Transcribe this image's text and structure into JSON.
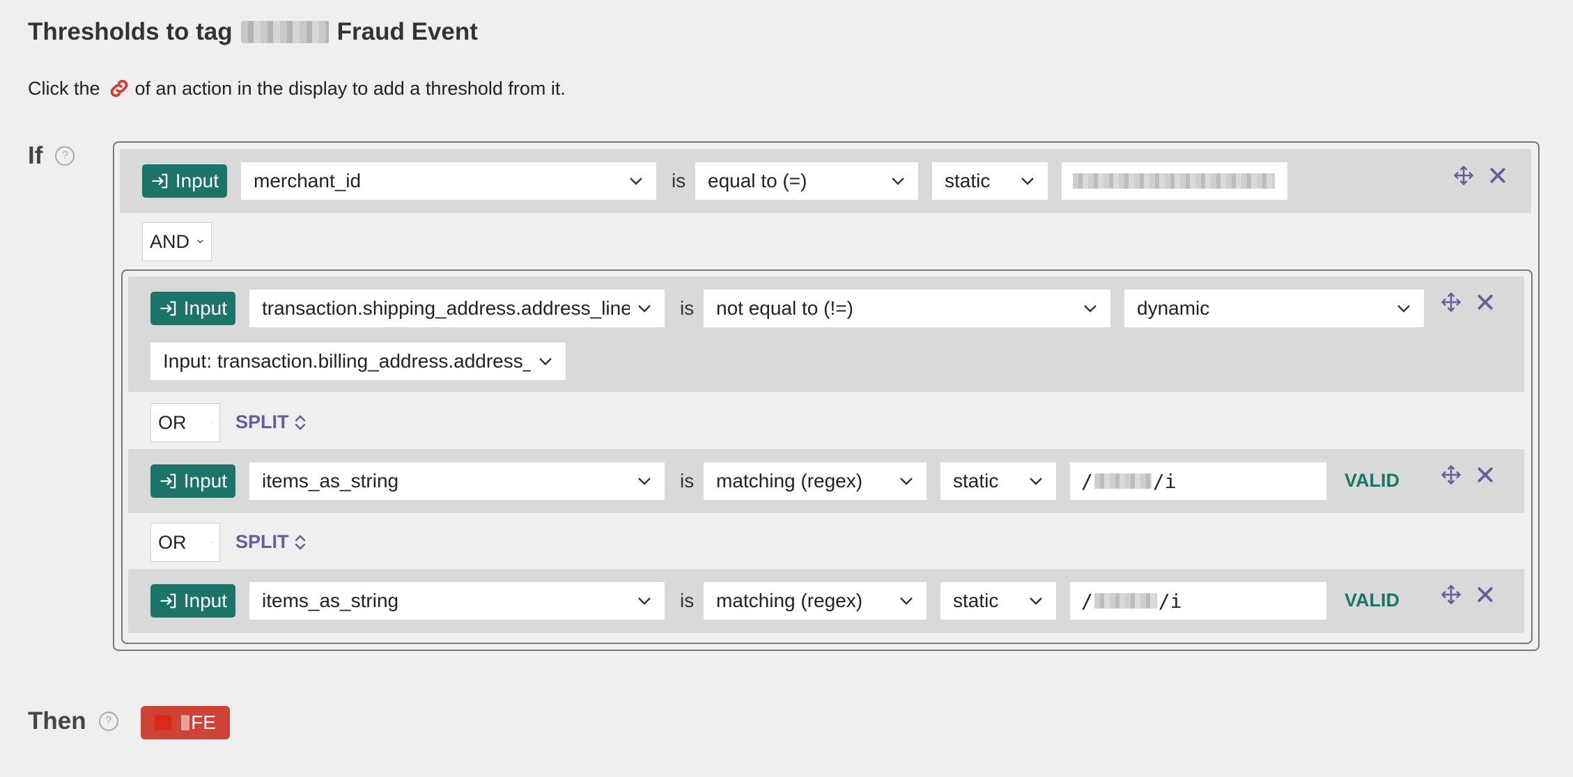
{
  "page": {
    "title_prefix": "Thresholds to tag",
    "title_suffix": "Fraud Event",
    "hint_before": "Click the",
    "hint_after": "of an action in the display to add a threshold from it."
  },
  "if_section": {
    "label": "If",
    "help": "?"
  },
  "then_section": {
    "label": "Then",
    "help": "?",
    "action_label": "FE"
  },
  "input_button_label": "Input",
  "is_label": "is",
  "valid_label": "VALID",
  "split_label": "SPLIT",
  "conditions": {
    "c1": {
      "field": "merchant_id",
      "operator": "equal to (=)",
      "mode": "static"
    },
    "c2": {
      "field": "transaction.shipping_address.address_line_",
      "operator": "not equal to (!=)",
      "mode": "dynamic",
      "dynamic_value": "Input: transaction.billing_address.address_l"
    },
    "c3": {
      "field": "items_as_string",
      "operator": "matching (regex)",
      "mode": "static",
      "value_prefix": "/",
      "value_suffix": "/i"
    },
    "c4": {
      "field": "items_as_string",
      "operator": "matching (regex)",
      "mode": "static",
      "value_prefix": "/",
      "value_suffix": "/i"
    }
  },
  "logic": {
    "top": "AND",
    "or1": "OR",
    "or2": "OR"
  },
  "colors": {
    "input_button": "#1c7368",
    "split": "#6b5a9c",
    "then_button": "#cf4337",
    "valid": "#1c7368"
  }
}
